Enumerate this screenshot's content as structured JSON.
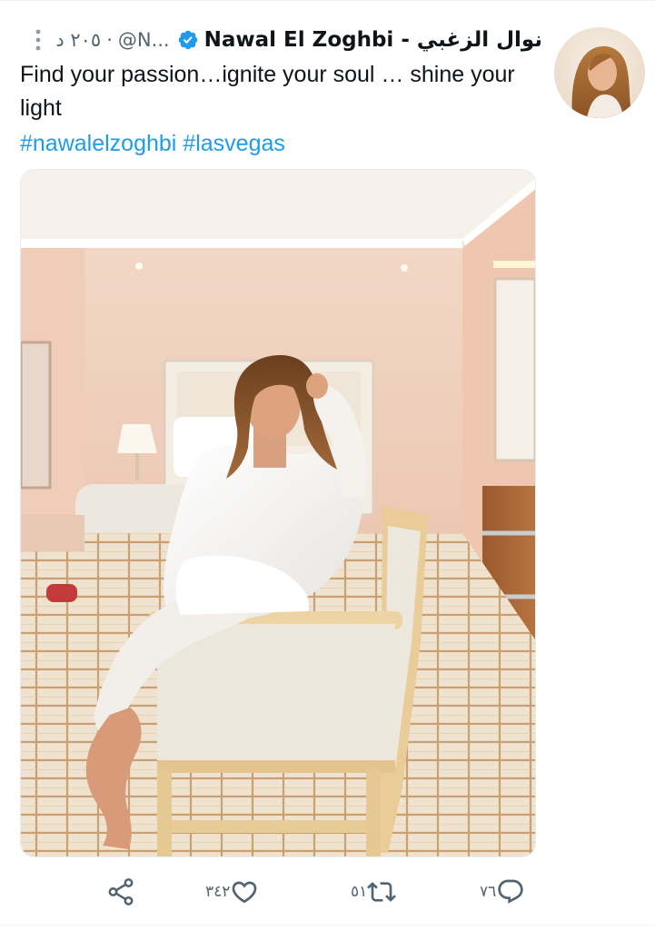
{
  "tweet": {
    "display_name": "نوال الزغبي - Nawal El Zoghbi",
    "verified": true,
    "handle": "@N...",
    "separator": "·",
    "timestamp": "٢٠٥ د",
    "text": "Find your passion…ignite your soul … shine your light",
    "hashtags": [
      "#nawalelzoghbi",
      "#lasvegas"
    ],
    "media_alt": "photo"
  },
  "actions": {
    "reply": {
      "icon": "reply-icon",
      "count": "٧٦"
    },
    "retweet": {
      "icon": "retweet-icon",
      "count": "٥١"
    },
    "like": {
      "icon": "heart-icon",
      "count": "٣٤٢"
    },
    "share": {
      "icon": "share-icon"
    }
  },
  "icons": {
    "verified": "verified-badge-icon",
    "more": "more-vertical-icon"
  },
  "colors": {
    "accent": "#1d9bf0",
    "text": "#0f1419",
    "secondary": "#536471"
  }
}
